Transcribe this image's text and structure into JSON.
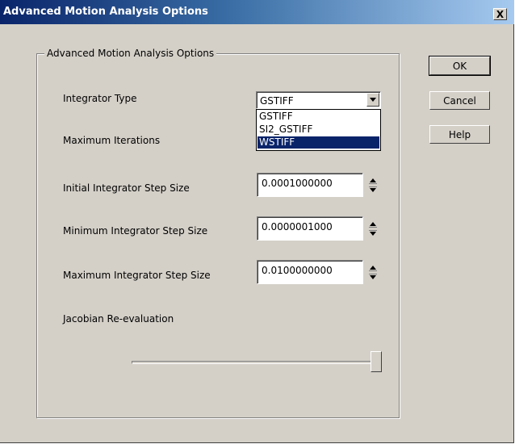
{
  "window": {
    "title": "Advanced Motion Analysis Options",
    "close_label": "X"
  },
  "group": {
    "legend": "Advanced Motion Analysis Options"
  },
  "fields": {
    "integrator_type": {
      "label": "Integrator Type",
      "value": "GSTIFF",
      "options": [
        "GSTIFF",
        "SI2_GSTIFF",
        "WSTIFF"
      ],
      "highlighted_option": "WSTIFF"
    },
    "max_iterations": {
      "label": "Maximum Iterations"
    },
    "initial_step": {
      "label": "Initial Integrator Step Size",
      "value": "0.0001000000"
    },
    "min_step": {
      "label": "Minimum Integrator Step Size",
      "value": "0.0000001000"
    },
    "max_step": {
      "label": "Maximum Integrator Step Size",
      "value": "0.0100000000"
    },
    "jacobian": {
      "label": "Jacobian Re-evaluation",
      "level": 1.0
    }
  },
  "buttons": {
    "ok": "OK",
    "cancel": "Cancel",
    "help": "Help"
  },
  "icons": {
    "combo_arrow": "triangle-down-icon",
    "spin": "spin-up-down-icon",
    "close": "close-icon"
  },
  "colors": {
    "face": "#d4d0c8",
    "title_start": "#0a246a",
    "title_end": "#a6caf0",
    "selection": "#0a246a"
  }
}
